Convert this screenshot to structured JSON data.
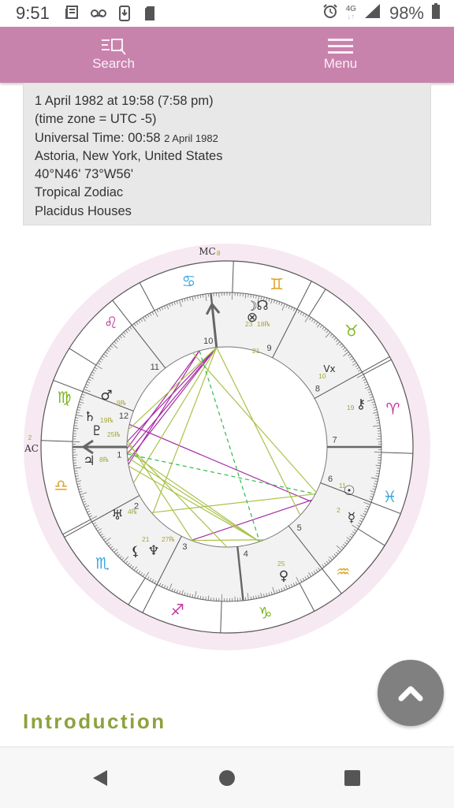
{
  "status_bar": {
    "time": "9:51",
    "left_icons": [
      "news-icon",
      "voicemail-icon",
      "download-icon",
      "sd-card-icon"
    ],
    "right_icons": [
      "alarm-icon",
      "4g-lte-icon",
      "signal-icon"
    ],
    "network": "4G",
    "battery_percent": "98%"
  },
  "header": {
    "search_label": "Search",
    "menu_label": "Menu",
    "color": "#c883ad"
  },
  "info": {
    "line1": "1 April 1982 at 19:58 (7:58 pm)",
    "line2": "(time zone = UTC -5)",
    "line3_main": "Universal Time: 00:58",
    "line3_small": "2 April 1982",
    "line4": "Astoria, New York, United States",
    "line5": "40°N46' 73°W56'",
    "line6": "Tropical Zodiac",
    "line7": "Placidus Houses"
  },
  "chart_data": {
    "type": "natal-wheel",
    "title": "",
    "ascendant": {
      "label": "AC",
      "degree": "2",
      "sign": "Libra"
    },
    "midheaven": {
      "label": "MC",
      "degree": "8",
      "sign": "Cancer"
    },
    "signs": [
      {
        "name": "Leo",
        "glyph": "♌",
        "color": "#c03a9a"
      },
      {
        "name": "Cancer",
        "glyph": "♋",
        "color": "#3aa6e0"
      },
      {
        "name": "Gemini",
        "glyph": "♊",
        "color": "#e0a020"
      },
      {
        "name": "Taurus",
        "glyph": "♉",
        "color": "#7ab51d"
      },
      {
        "name": "Aries",
        "glyph": "♈",
        "color": "#c03a9a"
      },
      {
        "name": "Pisces",
        "glyph": "♓",
        "color": "#3aa6e0"
      },
      {
        "name": "Aquarius",
        "glyph": "♒",
        "color": "#e0a020"
      },
      {
        "name": "Capricorn",
        "glyph": "♑",
        "color": "#7ab51d"
      },
      {
        "name": "Sagittarius",
        "glyph": "♐",
        "color": "#c03a9a"
      },
      {
        "name": "Scorpio",
        "glyph": "♏",
        "color": "#3aa6e0"
      },
      {
        "name": "Libra",
        "glyph": "♎",
        "color": "#e0a020"
      },
      {
        "name": "Virgo",
        "glyph": "♍",
        "color": "#7ab51d"
      }
    ],
    "houses": [
      "1",
      "2",
      "3",
      "4",
      "5",
      "6",
      "7",
      "8",
      "9",
      "10",
      "11",
      "12"
    ],
    "planets": [
      {
        "name": "Mars",
        "glyph": "♂",
        "degree": "9",
        "retro": true
      },
      {
        "name": "Saturn",
        "glyph": "♄",
        "degree": "19",
        "retro": true
      },
      {
        "name": "Pluto",
        "glyph": "♇",
        "degree": "25",
        "retro": true
      },
      {
        "name": "Jupiter",
        "glyph": "♃",
        "degree": "8",
        "retro": true
      },
      {
        "name": "Uranus",
        "glyph": "♅",
        "degree": "4",
        "retro": true
      },
      {
        "name": "Lilith",
        "glyph": "⚸",
        "degree": "21",
        "retro": false
      },
      {
        "name": "Neptune",
        "glyph": "♆",
        "degree": "27",
        "retro": true
      },
      {
        "name": "Venus",
        "glyph": "♀",
        "degree": "25",
        "retro": false
      },
      {
        "name": "Mercury",
        "glyph": "☿",
        "degree": "2",
        "retro": false
      },
      {
        "name": "Sun",
        "glyph": "☉",
        "degree": "11",
        "retro": false
      },
      {
        "name": "Chiron",
        "glyph": "⚷",
        "degree": "19",
        "retro": false
      },
      {
        "name": "Vertex",
        "glyph": "Vx",
        "degree": "10",
        "retro": false
      },
      {
        "name": "Moon",
        "glyph": "☽",
        "degree": "21",
        "retro": false
      },
      {
        "name": "North Node",
        "glyph": "☊",
        "degree": "18",
        "retro": true
      },
      {
        "name": "Part of Fortune",
        "glyph": "⊗",
        "degree": "23",
        "retro": false
      }
    ],
    "aspect_colors": {
      "trine_sextile": "#a9c24a",
      "square_opposition": "#a72aa3",
      "minor": "#33b84c"
    }
  },
  "content": {
    "section_heading": "Introduction"
  },
  "fab": {
    "icon": "chevron-up-icon"
  },
  "nav_bar": {
    "icons": [
      "back-icon",
      "home-icon",
      "recents-icon"
    ]
  }
}
